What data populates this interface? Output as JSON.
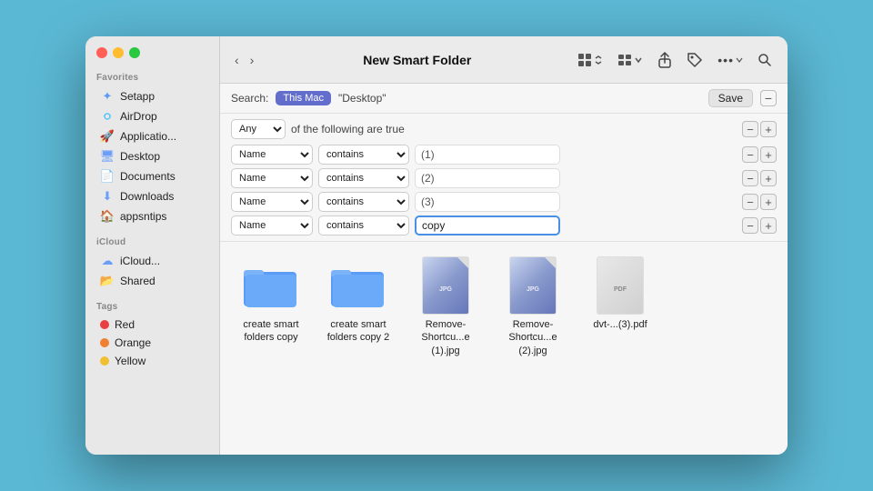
{
  "window": {
    "title": "New Smart Folder"
  },
  "toolbar": {
    "back_label": "‹",
    "forward_label": "›",
    "view_grid_label": "⊞",
    "view_list_label": "☰",
    "share_label": "↑",
    "tag_label": "🏷",
    "more_label": "•••",
    "search_label": "🔍"
  },
  "search_bar": {
    "search_prefix": "Search:",
    "this_mac_label": "This Mac",
    "desktop_label": "\"Desktop\"",
    "save_label": "Save"
  },
  "filter": {
    "any_label": "Any",
    "of_following": "of the following are true",
    "rows": [
      {
        "field": "Name",
        "condition": "contains",
        "value": "(1)"
      },
      {
        "field": "Name",
        "condition": "contains",
        "value": "(2)"
      },
      {
        "field": "Name",
        "condition": "contains",
        "value": "(3)"
      },
      {
        "field": "Name",
        "condition": "contains",
        "value": "copy"
      }
    ]
  },
  "sidebar": {
    "favorites_label": "Favorites",
    "icloud_label": "iCloud",
    "tags_label": "Tags",
    "items_favorites": [
      {
        "id": "setapp",
        "label": "Setapp",
        "icon": "✦",
        "color": "#5b9cf6"
      },
      {
        "id": "airdrop",
        "label": "AirDrop",
        "icon": "📡",
        "color": "#5b9cf6"
      },
      {
        "id": "applications",
        "label": "Applicatio...",
        "icon": "🚀",
        "color": "#f0654a"
      },
      {
        "id": "desktop",
        "label": "Desktop",
        "icon": "🖥",
        "color": "#6c9ef8"
      },
      {
        "id": "documents",
        "label": "Documents",
        "icon": "📄",
        "color": "#6c9ef8"
      },
      {
        "id": "downloads",
        "label": "Downloads",
        "icon": "⬇",
        "color": "#6c9ef8"
      },
      {
        "id": "appsntips",
        "label": "appsntips",
        "icon": "🏠",
        "color": "#6c9ef8"
      }
    ],
    "items_icloud": [
      {
        "id": "icloud",
        "label": "iCloud...",
        "icon": "☁",
        "color": "#6c9ef8"
      },
      {
        "id": "shared",
        "label": "Shared",
        "icon": "📂",
        "color": "#6c9ef8"
      }
    ],
    "tags": [
      {
        "label": "Red",
        "color": "#e84040"
      },
      {
        "label": "Orange",
        "color": "#f08030"
      },
      {
        "label": "Yellow",
        "color": "#f0c030"
      }
    ]
  },
  "files": [
    {
      "id": "folder1",
      "name": "create smart folders copy",
      "type": "folder"
    },
    {
      "id": "folder2",
      "name": "create smart folders copy 2",
      "type": "folder"
    },
    {
      "id": "jpg1",
      "name": "Remove-Shortcu...e (1).jpg",
      "type": "jpg"
    },
    {
      "id": "jpg2",
      "name": "Remove-Shortcu...e (2).jpg",
      "type": "jpg"
    },
    {
      "id": "pdf1",
      "name": "dvt-...(3).pdf",
      "type": "pdf"
    }
  ]
}
